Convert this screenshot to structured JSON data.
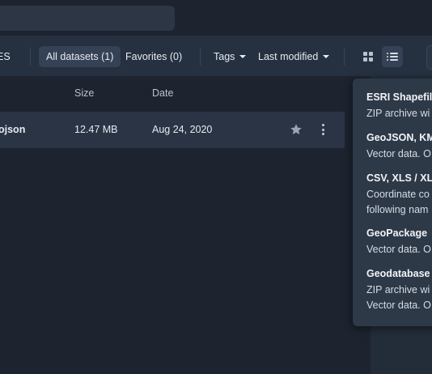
{
  "toolbar": {
    "left_cut_label": "ES",
    "tab_all": "All datasets (1)",
    "tab_favorites": "Favorites (0)",
    "tags_label": "Tags",
    "sort_label": "Last modified"
  },
  "table": {
    "headers": {
      "size": "Size",
      "date": "Date"
    },
    "rows": [
      {
        "name": "ojson",
        "size": "12.47 MB",
        "date": "Aug 24, 2020"
      }
    ]
  },
  "formats": [
    {
      "title": "ESRI Shapefile",
      "desc": [
        "ZIP archive wi"
      ]
    },
    {
      "title": "GeoJSON, KM",
      "desc": [
        "Vector data. O"
      ]
    },
    {
      "title": "CSV, XLS / XLS",
      "desc": [
        "Coordinate co",
        "following nam"
      ]
    },
    {
      "title": "GeoPackage",
      "desc": [
        "Vector data. O"
      ]
    },
    {
      "title": "Geodatabase",
      "desc": [
        "ZIP archive wi",
        "Vector data. O"
      ]
    }
  ],
  "colors": {
    "background": "#1d2430",
    "toolbar": "#253040",
    "active_tab": "#354256",
    "row": "#2a3444",
    "popover": "#2e3947"
  }
}
